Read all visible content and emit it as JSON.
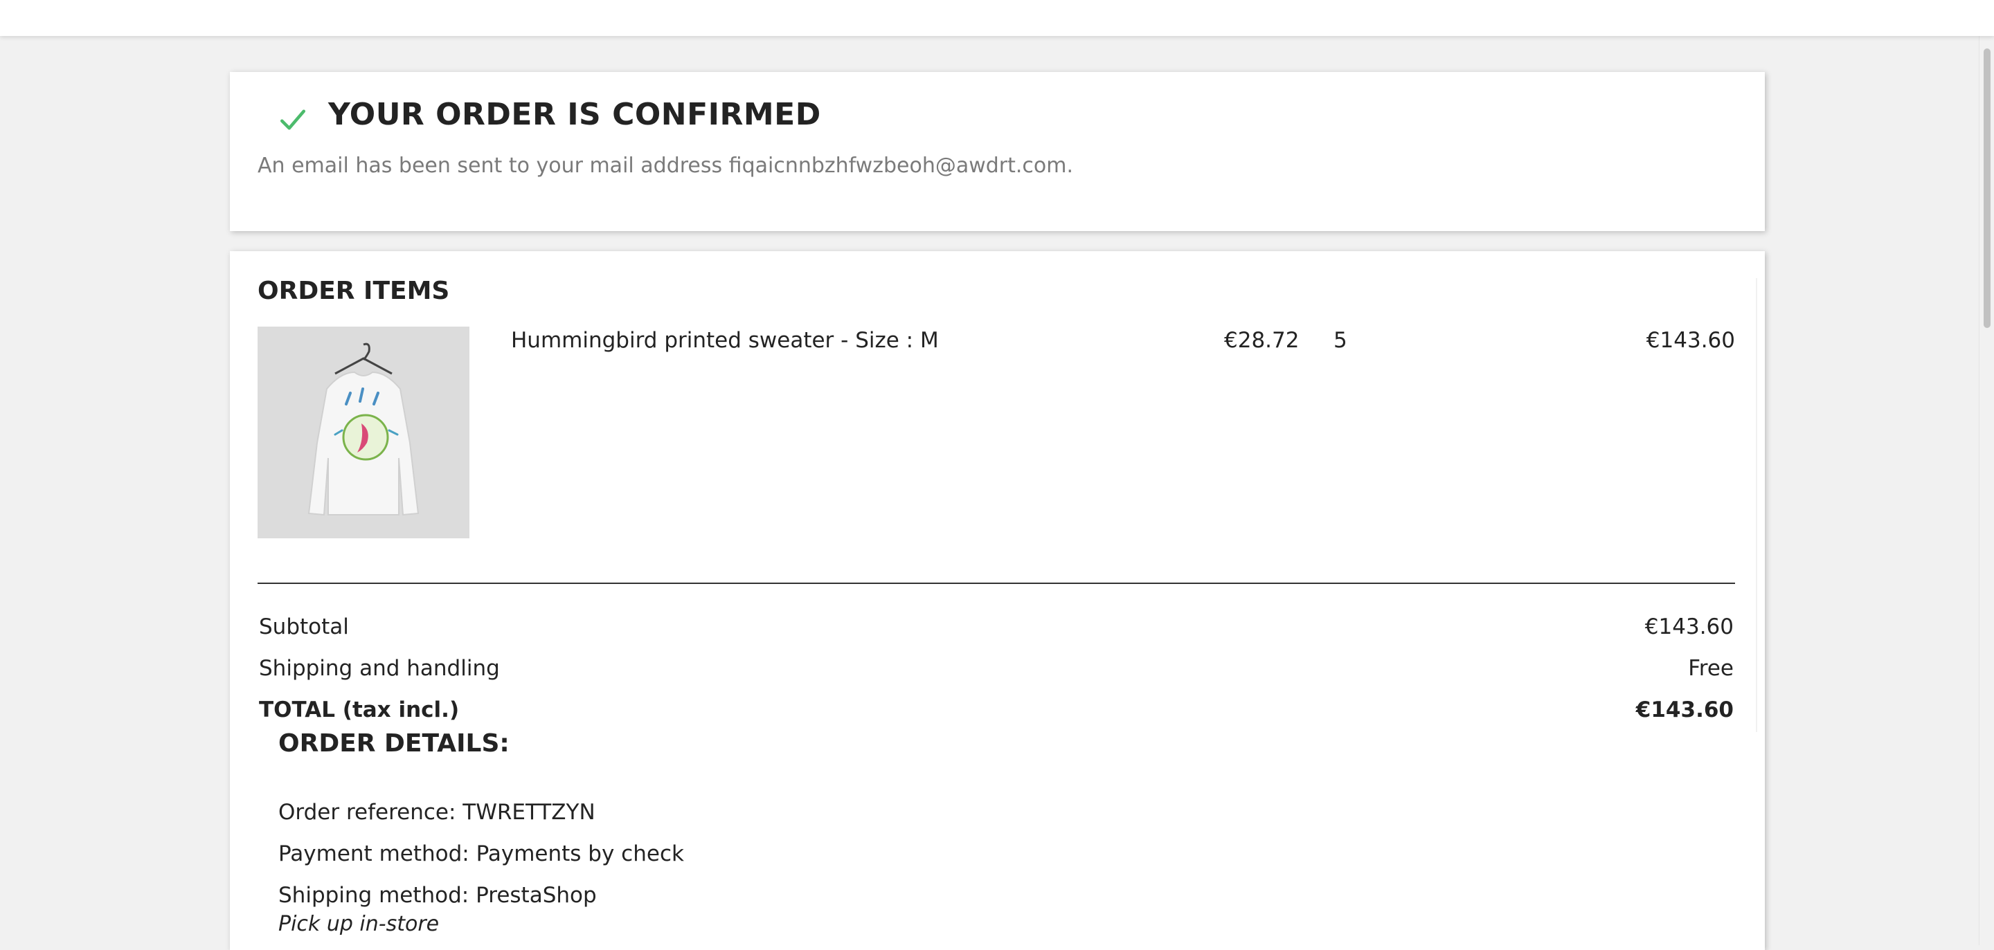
{
  "confirmation": {
    "title": "YOUR ORDER IS CONFIRMED",
    "message": "An email has been sent to your mail address fiqaicnnbzhfwzbeoh@awdrt.com."
  },
  "order_items": {
    "title": "ORDER ITEMS",
    "items": [
      {
        "name": "Hummingbird printed sweater - Size : M",
        "unit_price": "€28.72",
        "quantity": "5",
        "total": "€143.60"
      }
    ]
  },
  "summary": {
    "subtotal_label": "Subtotal",
    "subtotal_value": "€143.60",
    "shipping_label": "Shipping and handling",
    "shipping_value": "Free",
    "total_label": "TOTAL (tax incl.)",
    "total_value": "€143.60"
  },
  "details": {
    "title": "ORDER DETAILS:",
    "reference": "Order reference: TWRETTZYN",
    "payment": "Payment method: Payments by check",
    "shipping": "Shipping method: PrestaShop",
    "shipping_note": "Pick up in-store"
  },
  "colors": {
    "check": "#4cbb6c",
    "page_bg": "#f1f1f1",
    "text": "#232323",
    "muted": "#7a7a7a"
  },
  "icons": [
    "check-icon",
    "product-image"
  ]
}
